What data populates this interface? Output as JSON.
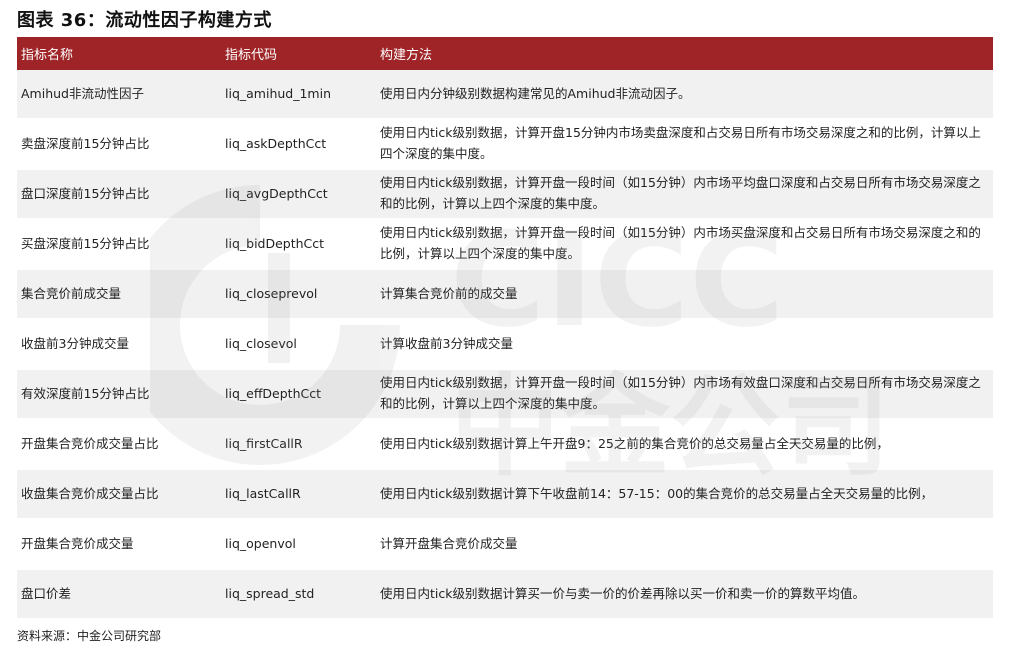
{
  "title": "图表 36：流动性因子构建方式",
  "table": {
    "headers": [
      "指标名称",
      "指标代码",
      "构建方法"
    ],
    "rows": [
      {
        "name": "Amihud非流动性因子",
        "code": "liq_amihud_1min",
        "desc": "使用日内分钟级别数据构建常见的Amihud非流动因子。"
      },
      {
        "name": "卖盘深度前15分钟占比",
        "code": "liq_askDepthCct",
        "desc": "使用日内tick级别数据，计算开盘15分钟内市场卖盘深度和占交易日所有市场交易深度之和的比例，计算以上四个深度的集中度。"
      },
      {
        "name": "盘口深度前15分钟占比",
        "code": "liq_avgDepthCct",
        "desc": "使用日内tick级别数据，计算开盘一段时间（如15分钟）内市场平均盘口深度和占交易日所有市场交易深度之和的比例，计算以上四个深度的集中度。"
      },
      {
        "name": "买盘深度前15分钟占比",
        "code": "liq_bidDepthCct",
        "desc": "使用日内tick级别数据，计算开盘一段时间（如15分钟）内市场买盘深度和占交易日所有市场交易深度之和的比例，计算以上四个深度的集中度。"
      },
      {
        "name": "集合竞价前成交量",
        "code": "liq_closeprevol",
        "desc": "计算集合竞价前的成交量"
      },
      {
        "name": "收盘前3分钟成交量",
        "code": "liq_closevol",
        "desc": "计算收盘前3分钟成交量"
      },
      {
        "name": "有效深度前15分钟占比",
        "code": "liq_effDepthCct",
        "desc": "使用日内tick级别数据，计算开盘一段时间（如15分钟）内市场有效盘口深度和占交易日所有市场交易深度之和的比例，计算以上四个深度的集中度。"
      },
      {
        "name": "开盘集合竞价成交量占比",
        "code": "liq_firstCallR",
        "desc": "使用日内tick级别数据计算上午开盘9：25之前的集合竞价的总交易量占全天交易量的比例，"
      },
      {
        "name": "收盘集合竞价成交量占比",
        "code": "liq_lastCallR",
        "desc": "使用日内tick级别数据计算下午收盘前14：57-15：00的集合竞价的总交易量占全天交易量的比例，"
      },
      {
        "name": "开盘集合竞价成交量",
        "code": "liq_openvol",
        "desc": "计算开盘集合竞价成交量"
      },
      {
        "name": "盘口价差",
        "code": "liq_spread_std",
        "desc": "使用日内tick级别数据计算买一价与卖一价的价差再除以买一价和卖一价的算数平均值。"
      }
    ]
  },
  "watermark": {
    "latin": "CICC",
    "chinese": "中金公司"
  },
  "source": "资料来源：中金公司研究部",
  "colors": {
    "header_bg": "#9e2427",
    "header_text": "#ffffff",
    "stripe": "#f1f1f1"
  }
}
